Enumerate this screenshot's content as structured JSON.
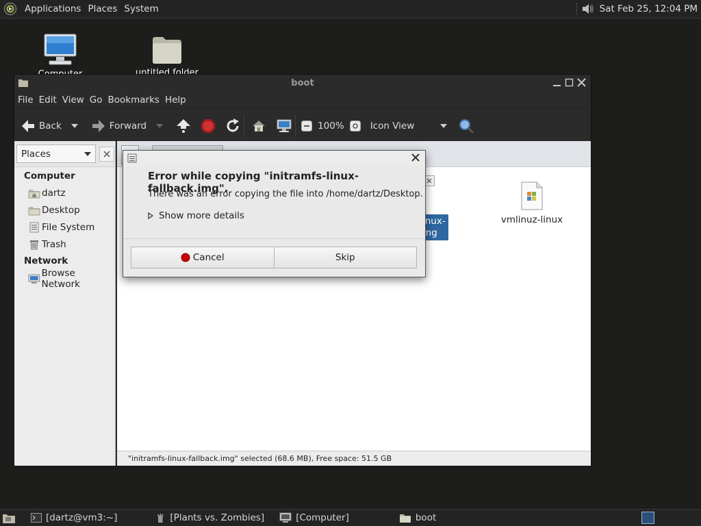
{
  "top_panel": {
    "menus": [
      "Applications",
      "Places",
      "System"
    ],
    "clock": "Sat Feb 25, 12:04 PM",
    "icons": {
      "logo": "distro-logo-icon",
      "volume": "speaker-icon"
    }
  },
  "desktop": {
    "icons": [
      {
        "label": "Computer",
        "icon": "monitor-icon"
      },
      {
        "label": "untitled folder",
        "icon": "folder-icon"
      }
    ]
  },
  "file_manager": {
    "title": "boot",
    "menu": [
      "File",
      "Edit",
      "View",
      "Go",
      "Bookmarks",
      "Help"
    ],
    "toolbar": {
      "back": "Back",
      "forward": "Forward",
      "zoom": "100%",
      "view_mode": "Icon View"
    },
    "sidebar": {
      "selector": "Places",
      "sections": [
        {
          "heading": "Computer",
          "items": [
            "dartz",
            "Desktop",
            "File System",
            "Trash"
          ]
        },
        {
          "heading": "Network",
          "items": [
            "Browse Network"
          ]
        }
      ]
    },
    "files": {
      "selected_partial_label_1": "inux-",
      "selected_partial_label_2": "mg",
      "other_file": "vmlinuz-linux"
    },
    "status": "\"initramfs-linux-fallback.img\" selected (68.6 MB), Free space: 51.5 GB"
  },
  "dialog": {
    "heading": "Error while copying \"initramfs-linux-fallback.img\".",
    "message": "There was an error copying the file into /home/dartz/Desktop.",
    "details_toggle": "Show more details",
    "buttons": {
      "cancel": "Cancel",
      "skip": "Skip"
    }
  },
  "taskbar": {
    "tasks": [
      "[dartz@vm3:~]",
      "[Plants vs. Zombies]",
      "[Computer]",
      "boot"
    ]
  },
  "colors": {
    "panel_bg": "#232323",
    "desktop_bg": "#1d1d1b",
    "selection": "#2f67a0",
    "cancel_red": "#cc0000"
  }
}
